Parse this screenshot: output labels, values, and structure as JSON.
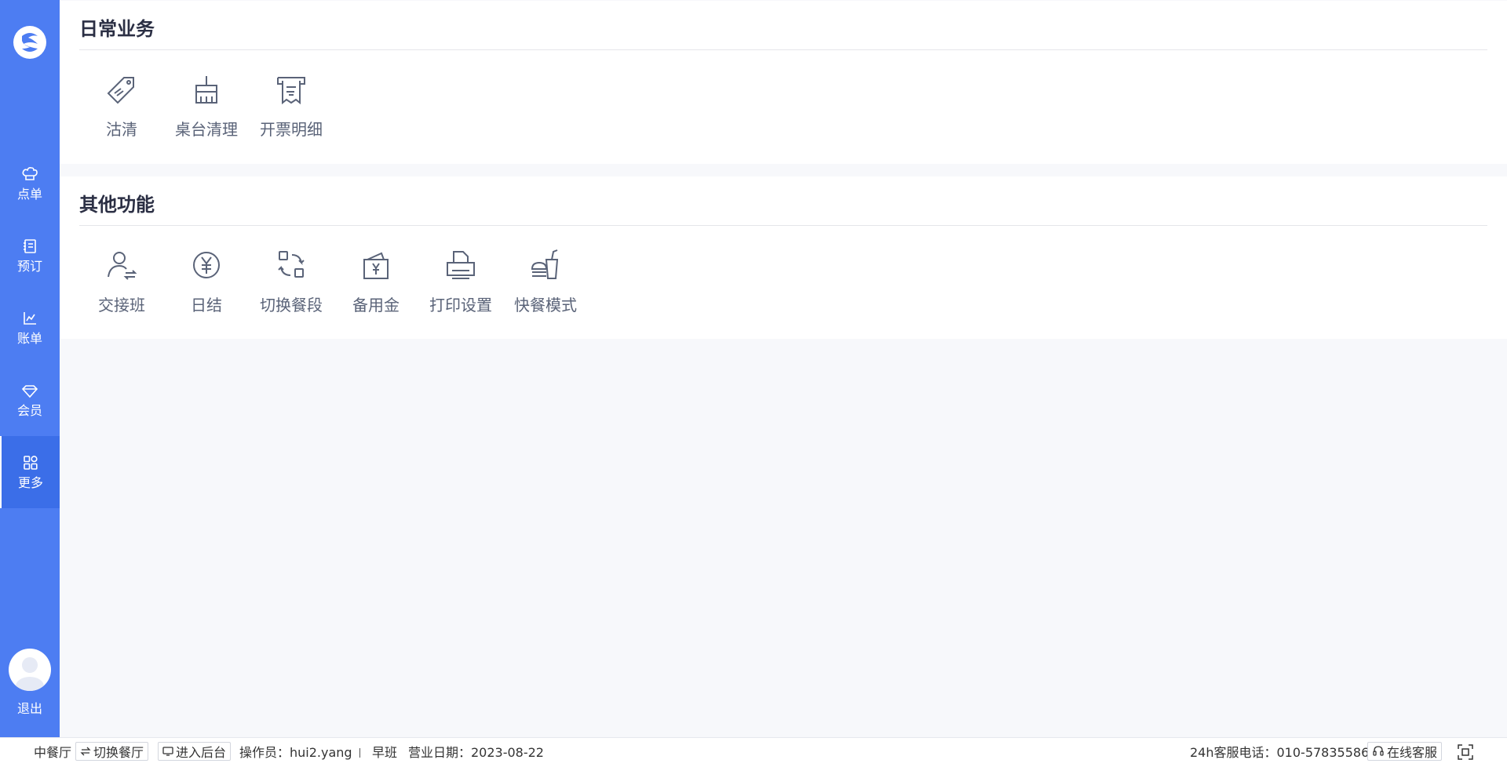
{
  "sidebar": {
    "nav": [
      {
        "label": "点单",
        "icon": "chef-hat-icon"
      },
      {
        "label": "预订",
        "icon": "notebook-icon"
      },
      {
        "label": "账单",
        "icon": "chart-icon"
      },
      {
        "label": "会员",
        "icon": "diamond-icon"
      },
      {
        "label": "更多",
        "icon": "grid-icon"
      }
    ],
    "active": "更多",
    "logout": "退出"
  },
  "sections": [
    {
      "title": "日常业务",
      "items": [
        {
          "label": "沽清",
          "icon": "tag-icon"
        },
        {
          "label": "桌台清理",
          "icon": "broom-icon"
        },
        {
          "label": "开票明细",
          "icon": "invoice-icon"
        }
      ]
    },
    {
      "title": "其他功能",
      "items": [
        {
          "label": "交接班",
          "icon": "handover-icon"
        },
        {
          "label": "日结",
          "icon": "yuan-coin-icon"
        },
        {
          "label": "切换餐段",
          "icon": "switch-icon"
        },
        {
          "label": "备用金",
          "icon": "wallet-icon"
        },
        {
          "label": "打印设置",
          "icon": "printer-icon"
        },
        {
          "label": "快餐模式",
          "icon": "fast-food-icon"
        }
      ]
    }
  ],
  "footer": {
    "restaurant": "中餐厅",
    "switch_restaurant": "切换餐厅",
    "enter_backend": "进入后台",
    "operator": "操作员：hui2.yang",
    "shift": "早班",
    "business_date": "营业日期：2023-08-22",
    "hotline": "24h客服电话：010-57835586",
    "online_service": "在线客服"
  },
  "colors": {
    "primary": "#4d7df2",
    "active": "#3b6ee8",
    "icon": "#5a6378"
  }
}
